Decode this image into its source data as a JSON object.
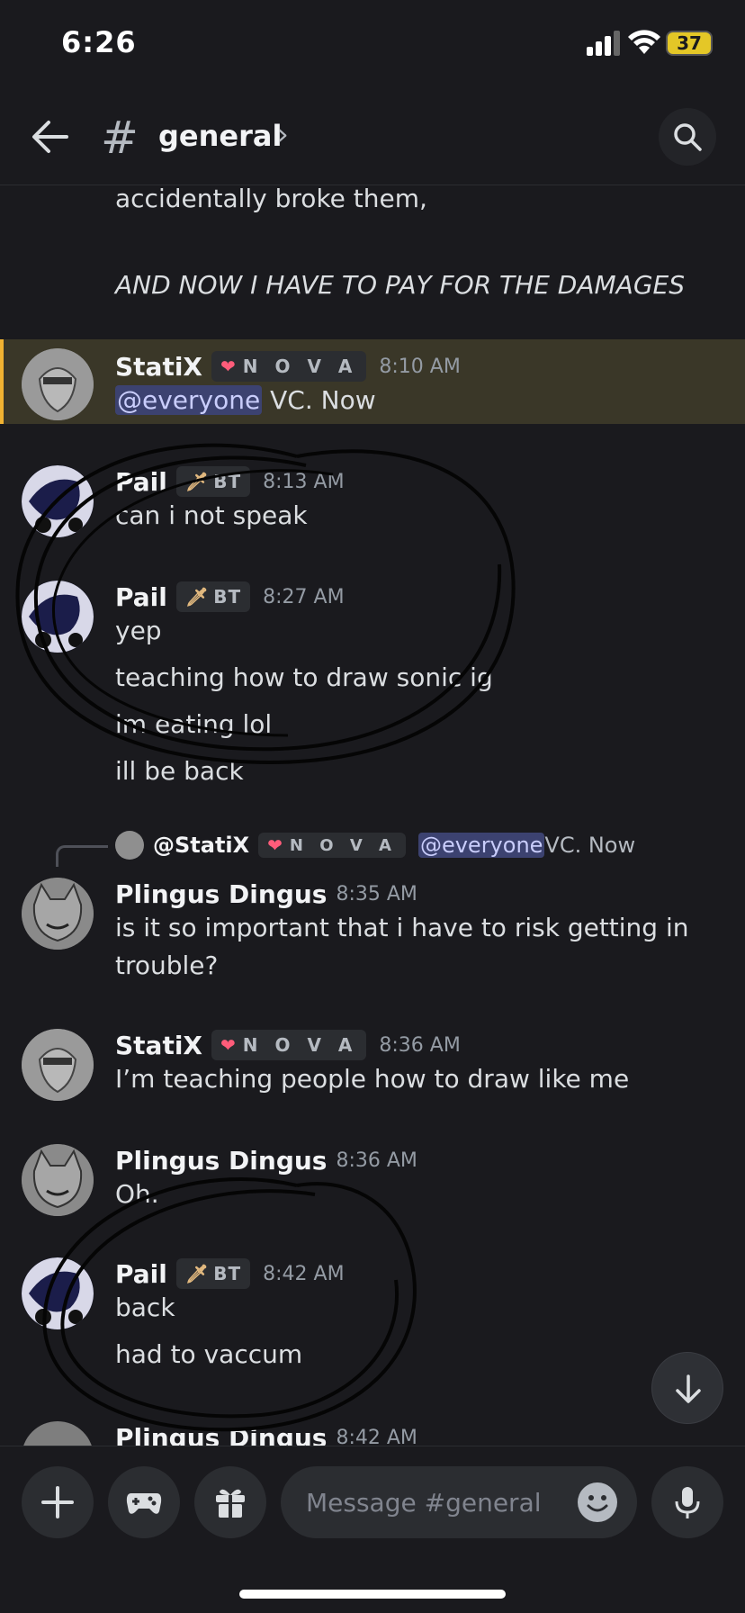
{
  "status_bar": {
    "time": "6:26",
    "battery": "37"
  },
  "header": {
    "channel": "general",
    "chevron": "›"
  },
  "messages": {
    "partial": {
      "line1": "accidentally broke them,",
      "line2": "AND NOW I HAVE TO PAY FOR THE DAMAGES"
    },
    "m1": {
      "author": "StatiX",
      "badge": "N O V A",
      "time": "8:10 AM",
      "mention": "@everyone",
      "text": " VC. Now"
    },
    "m2": {
      "author": "Pail",
      "badge": "BT",
      "time": "8:13 AM",
      "text": "can i not speak"
    },
    "m3": {
      "author": "Pail",
      "badge": "BT",
      "time": "8:27 AM",
      "lines": [
        "yep",
        "teaching how to draw sonic ig",
        "im eating lol",
        "ill be back"
      ]
    },
    "reply": {
      "author": "@StatiX",
      "badge": "N O V A",
      "mention": "@everyone",
      "text": " VC. Now"
    },
    "m4": {
      "author": "Plingus Dingus",
      "time": "8:35 AM",
      "line1": "is it so important that i have to risk getting in",
      "line2": "trouble?"
    },
    "m5": {
      "author": "StatiX",
      "badge": "N O V A",
      "time": "8:36 AM",
      "text": "I’m teaching people how to draw like me"
    },
    "m6": {
      "author": "Plingus Dingus",
      "time": "8:36 AM",
      "text": "Oh."
    },
    "m7": {
      "author": "Pail",
      "badge": "BT",
      "time": "8:42 AM",
      "lines": [
        "back",
        "had to vaccum"
      ]
    },
    "m8": {
      "author": "Plingus Dingus",
      "time": "8:42 AM"
    }
  },
  "input": {
    "placeholder": "Message #general"
  },
  "icons": {
    "heart": "❤",
    "sword": "🗡"
  }
}
